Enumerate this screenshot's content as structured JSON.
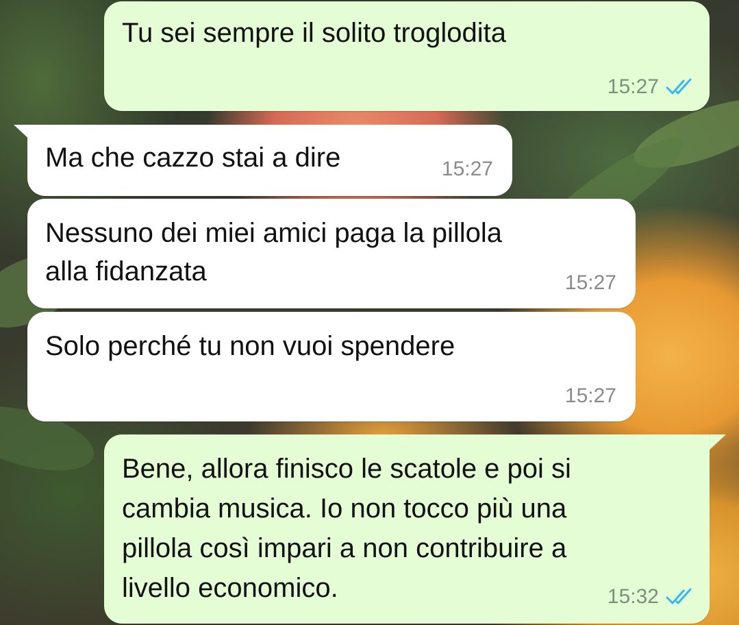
{
  "messages": [
    {
      "direction": "outgoing",
      "lines": [
        "Tu sei sempre il solito troglodita"
      ],
      "time": "15:27",
      "status_icon": "double-check-read-icon"
    },
    {
      "direction": "incoming",
      "lines": [
        "Ma che cazzo stai a dire"
      ],
      "time": "15:27"
    },
    {
      "direction": "incoming",
      "lines": [
        "Nessuno dei miei amici paga la pillola",
        "alla fidanzata"
      ],
      "time": "15:27"
    },
    {
      "direction": "incoming",
      "lines": [
        "Solo perché tu non vuoi spendere"
      ],
      "time": "15:27"
    },
    {
      "direction": "outgoing",
      "lines": [
        "Bene, allora finisco le scatole e poi si",
        "cambia musica. Io non tocco più una",
        "pillola così impari a non contribuire a",
        "livello economico."
      ],
      "time": "15:32",
      "status_icon": "double-check-read-icon"
    }
  ],
  "colors": {
    "outgoing_bubble": "#e5fdd5",
    "incoming_bubble": "#ffffff",
    "read_tick": "#34b7f1",
    "timestamp": "#8a8a8a"
  }
}
